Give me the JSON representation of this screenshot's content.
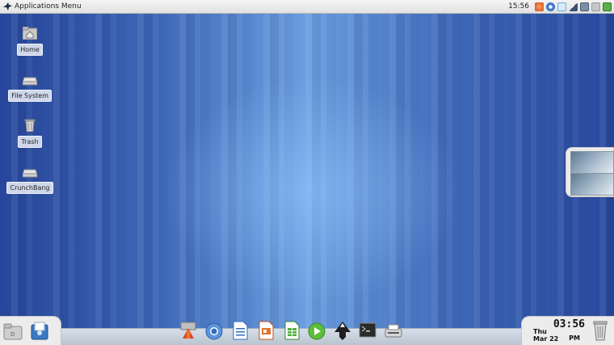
{
  "top_panel": {
    "menu_label": "Applications Menu",
    "clock": "15:56",
    "tray_icons": [
      "notification-icon",
      "chromium-tray-icon",
      "dropbox-icon",
      "network-signal-icon",
      "display-settings-icon",
      "power-icon",
      "green-app-icon"
    ]
  },
  "desktop": {
    "icons": [
      {
        "name": "home-folder-icon",
        "label": "Home"
      },
      {
        "name": "drive-icon",
        "label": "File System"
      },
      {
        "name": "trash-icon",
        "label": "Trash"
      },
      {
        "name": "drive-icon",
        "label": "CrunchBang"
      }
    ]
  },
  "dock": {
    "left_items": [
      "files-folder-icon",
      "user-home-icon"
    ],
    "launchers": [
      "system-tools-icon",
      "chromium-browser-icon",
      "libreoffice-writer-icon",
      "libreoffice-impress-icon",
      "libreoffice-calc-icon",
      "media-player-icon",
      "inkscape-icon",
      "terminal-icon",
      "scanner-icon"
    ],
    "clock": {
      "time": "03:56",
      "day": "Thu",
      "date": "Mar 22",
      "ampm": "PM"
    },
    "trash_icon": "trash-icon"
  },
  "colors": {
    "desktop_center": "#6b9ee0",
    "desktop_edge": "#27469b",
    "panel_bg": "#ececec"
  }
}
